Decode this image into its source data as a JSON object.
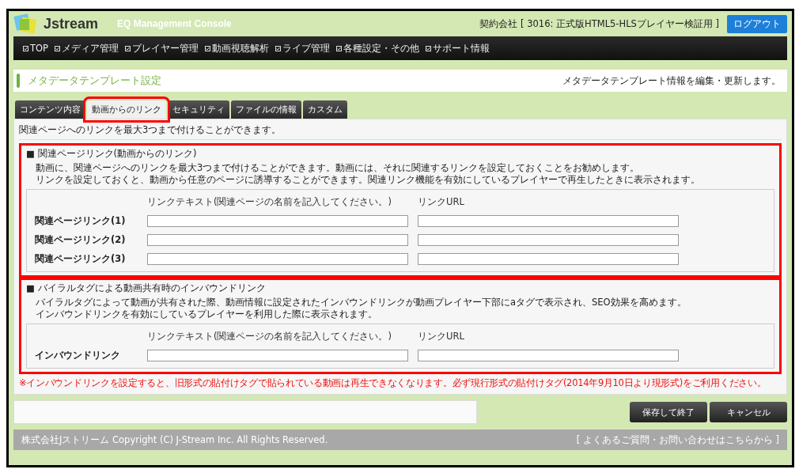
{
  "header": {
    "logo": "Jstream",
    "title": "EQ Management Console",
    "contract": "契約会社 [ 3016: 正式版HTML5-HLSプレイヤー検証用 ]",
    "logout": "ログアウト"
  },
  "nav": [
    "TOP",
    "メディア管理",
    "プレイヤー管理",
    "動画視聴解析",
    "ライブ管理",
    "各種設定・その他",
    "サポート情報"
  ],
  "page": {
    "title": "メタデータテンプレート設定",
    "description": "メタデータテンプレート情報を編集・更新します。"
  },
  "tabs": [
    {
      "label": "コンテンツ内容",
      "selected": false,
      "highlighted": false
    },
    {
      "label": "動画からのリンク",
      "selected": true,
      "highlighted": true
    },
    {
      "label": "セキュリティ",
      "selected": false,
      "highlighted": false
    },
    {
      "label": "ファイルの情報",
      "selected": false,
      "highlighted": false
    },
    {
      "label": "カスタム",
      "selected": false,
      "highlighted": false
    }
  ],
  "intro": "関連ページへのリンクを最大3つまで付けることができます。",
  "sections": [
    {
      "heading": "■ 関連ページリンク(動画からのリンク)",
      "highlighted": true,
      "description": [
        "動画に、関連ページへのリンクを最大3つまで付けることができます。動画には、それに関連するリンクを設定しておくことをお勧めします。",
        "リンクを設定しておくと、動画から任意のページに誘導することができます。関連リンク機能を有効にしているプレイヤーで再生したときに表示されます。"
      ],
      "columns": [
        "リンクテキスト(関連ページの名前を記入してください。)",
        "リンクURL"
      ],
      "rows": [
        "関連ページリンク(1)",
        "関連ページリンク(2)",
        "関連ページリンク(3)"
      ]
    },
    {
      "heading": "■ バイラルタグによる動画共有時のインバウンドリンク",
      "highlighted": true,
      "description": [
        "バイラルタグによって動画が共有された際、動画情報に設定されたインバウンドリンクが動画プレイヤー下部にaタグで表示され、SEO効果を高めます。",
        "インバウンドリンクを有効にしているプレイヤーを利用した際に表示されます。"
      ],
      "columns": [
        "リンクテキスト(関連ページの名前を記入してください。)",
        "リンクURL"
      ],
      "rows": [
        "インバウンドリンク"
      ]
    }
  ],
  "note": "※インバウンドリンクを設定すると、旧形式の貼付けタグで貼られている動画は再生できなくなります。必ず現行形式の貼付けタグ(2014年9月10日より現形式)をご利用ください。",
  "buttons": [
    "保存して終了",
    "キャンセル"
  ],
  "footer": {
    "copyright": "株式会社Jストリーム Copyright (C) J-Stream Inc. All Rights Reserved.",
    "help": "[ よくあるご質問・お問い合わせはこちらから ]"
  }
}
